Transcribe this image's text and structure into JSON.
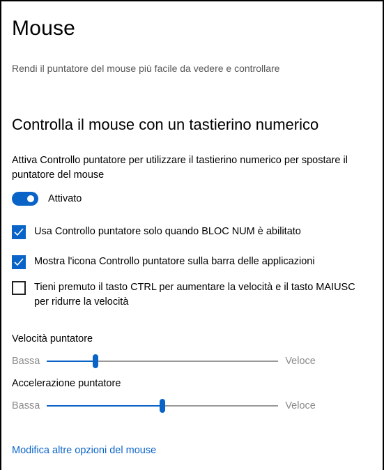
{
  "page": {
    "title": "Mouse",
    "subtitle": "Rendi il puntatore del mouse più facile da vedere e controllare"
  },
  "section": {
    "heading": "Controlla il mouse con un tastierino numerico",
    "description": "Attiva Controllo puntatore per utilizzare il tastierino numerico per spostare il puntatore del mouse"
  },
  "toggle": {
    "label": "Attivato",
    "on": true
  },
  "options": [
    {
      "label": "Usa Controllo puntatore solo quando BLOC NUM è abilitato",
      "checked": true
    },
    {
      "label": "Mostra l'icona Controllo puntatore sulla barra delle applicazioni",
      "checked": true
    },
    {
      "label": "Tieni premuto il tasto CTRL per aumentare la velocità e il tasto MAIUSC per ridurre la velocità",
      "checked": false
    }
  ],
  "sliders": {
    "speed": {
      "title": "Velocità puntatore",
      "min_label": "Bassa",
      "max_label": "Veloce",
      "value_fraction": 0.21
    },
    "acceleration": {
      "title": "Accelerazione puntatore",
      "min_label": "Bassa",
      "max_label": "Veloce",
      "value_fraction": 0.5
    }
  },
  "link": {
    "label": "Modifica altre opzioni del mouse"
  },
  "colors": {
    "accent": "#0a64c8",
    "track": "#999999",
    "secondary_text": "#8a8a8a"
  }
}
